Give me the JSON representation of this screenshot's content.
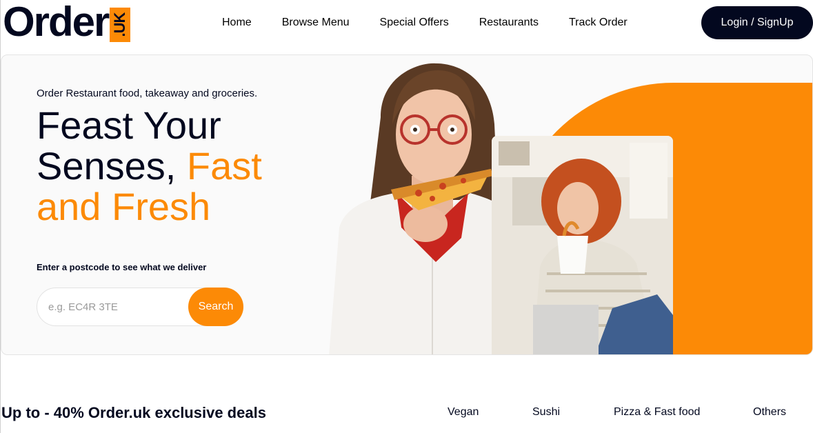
{
  "brand": {
    "logo_text": "Order",
    "logo_badge": ".UK",
    "accent_color": "#fc8a06",
    "dark_color": "#03081f"
  },
  "nav": {
    "items": [
      {
        "label": "Home"
      },
      {
        "label": "Browse Menu"
      },
      {
        "label": "Special Offers"
      },
      {
        "label": "Restaurants"
      },
      {
        "label": "Track Order"
      }
    ],
    "login_label": "Login / SignUp"
  },
  "hero": {
    "tagline": "Order Restaurant food, takeaway and groceries.",
    "headline_line1": "Feast Your",
    "headline_line2_plain": "Senses, ",
    "headline_line2_accent": "Fast",
    "headline_line3_accent": "and Fresh",
    "postcode_label": "Enter a postcode to see what we deliver",
    "search_placeholder": "e.g. EC4R 3TE",
    "search_button": "Search"
  },
  "deals": {
    "title": "Up to - 40% Order.uk exclusive deals",
    "filters": [
      {
        "label": "Vegan"
      },
      {
        "label": "Sushi"
      },
      {
        "label": "Pizza & Fast food"
      },
      {
        "label": "Others"
      }
    ]
  }
}
